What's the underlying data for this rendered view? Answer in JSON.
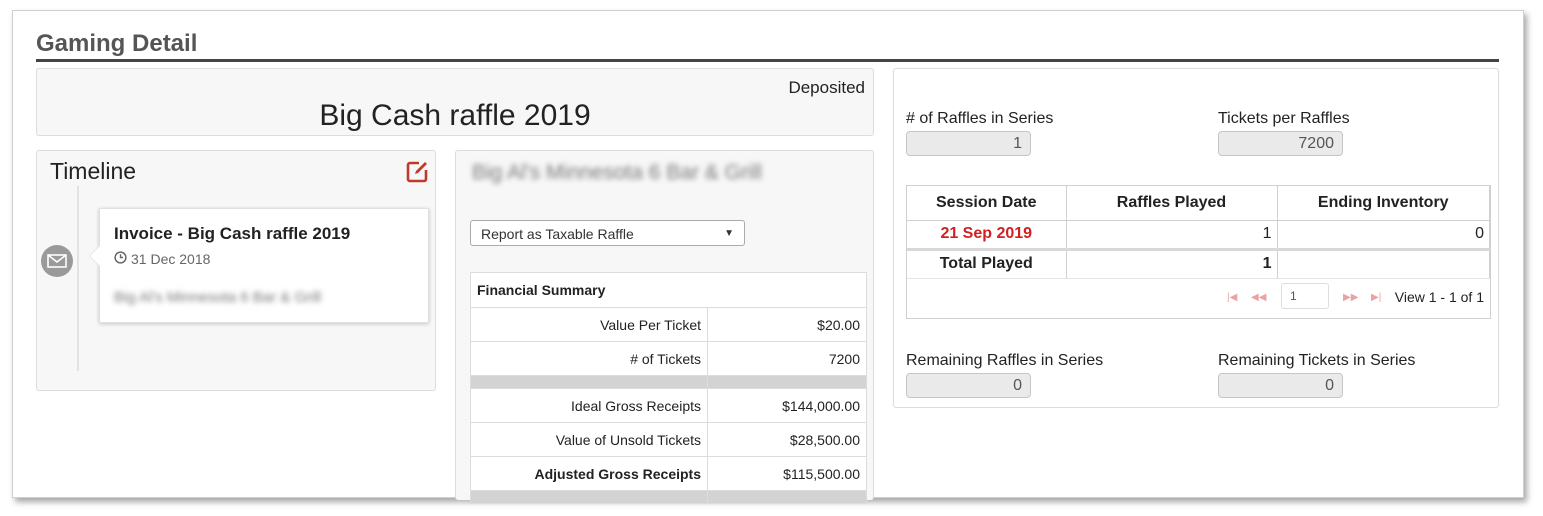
{
  "header": {
    "title": "Gaming Detail"
  },
  "summary": {
    "status": "Deposited",
    "raffle_name": "Big Cash raffle 2019"
  },
  "timeline": {
    "title": "Timeline",
    "entry": {
      "title": "Invoice - Big Cash raffle 2019",
      "date": "31 Dec 2018",
      "org": "Big Al's Minnesota 6 Bar & Grill"
    }
  },
  "organization": {
    "name": "Big Al's Minnesota 6 Bar & Grill",
    "report_select": "Report as Taxable Raffle"
  },
  "financial": {
    "title": "Financial Summary",
    "rows": [
      {
        "label": "Value Per Ticket",
        "value": "$20.00"
      },
      {
        "label": "# of Tickets",
        "value": "7200"
      },
      {
        "label": "Ideal Gross Receipts",
        "value": "$144,000.00"
      },
      {
        "label": "Value of Unsold Tickets",
        "value": "$28,500.00"
      },
      {
        "label": "Adjusted Gross Receipts",
        "value": "$115,500.00"
      }
    ]
  },
  "series": {
    "raffles_label": "# of Raffles in Series",
    "raffles_value": "1",
    "tickets_label": "Tickets per Raffles",
    "tickets_value": "7200",
    "remaining_raffles_label": "Remaining Raffles in Series",
    "remaining_raffles_value": "0",
    "remaining_tickets_label": "Remaining Tickets in Series",
    "remaining_tickets_value": "0"
  },
  "sessions": {
    "columns": [
      "Session Date",
      "Raffles Played",
      "Ending Inventory"
    ],
    "rows": [
      {
        "date": "21 Sep 2019",
        "played": "1",
        "inventory": "0"
      }
    ],
    "total": {
      "label": "Total Played",
      "played": "1"
    },
    "pager": {
      "page": "1",
      "info": "View 1 - 1 of 1"
    }
  },
  "colors": {
    "accent": "#d22020",
    "edit_icon": "#c0392b",
    "rule": "#444444"
  }
}
